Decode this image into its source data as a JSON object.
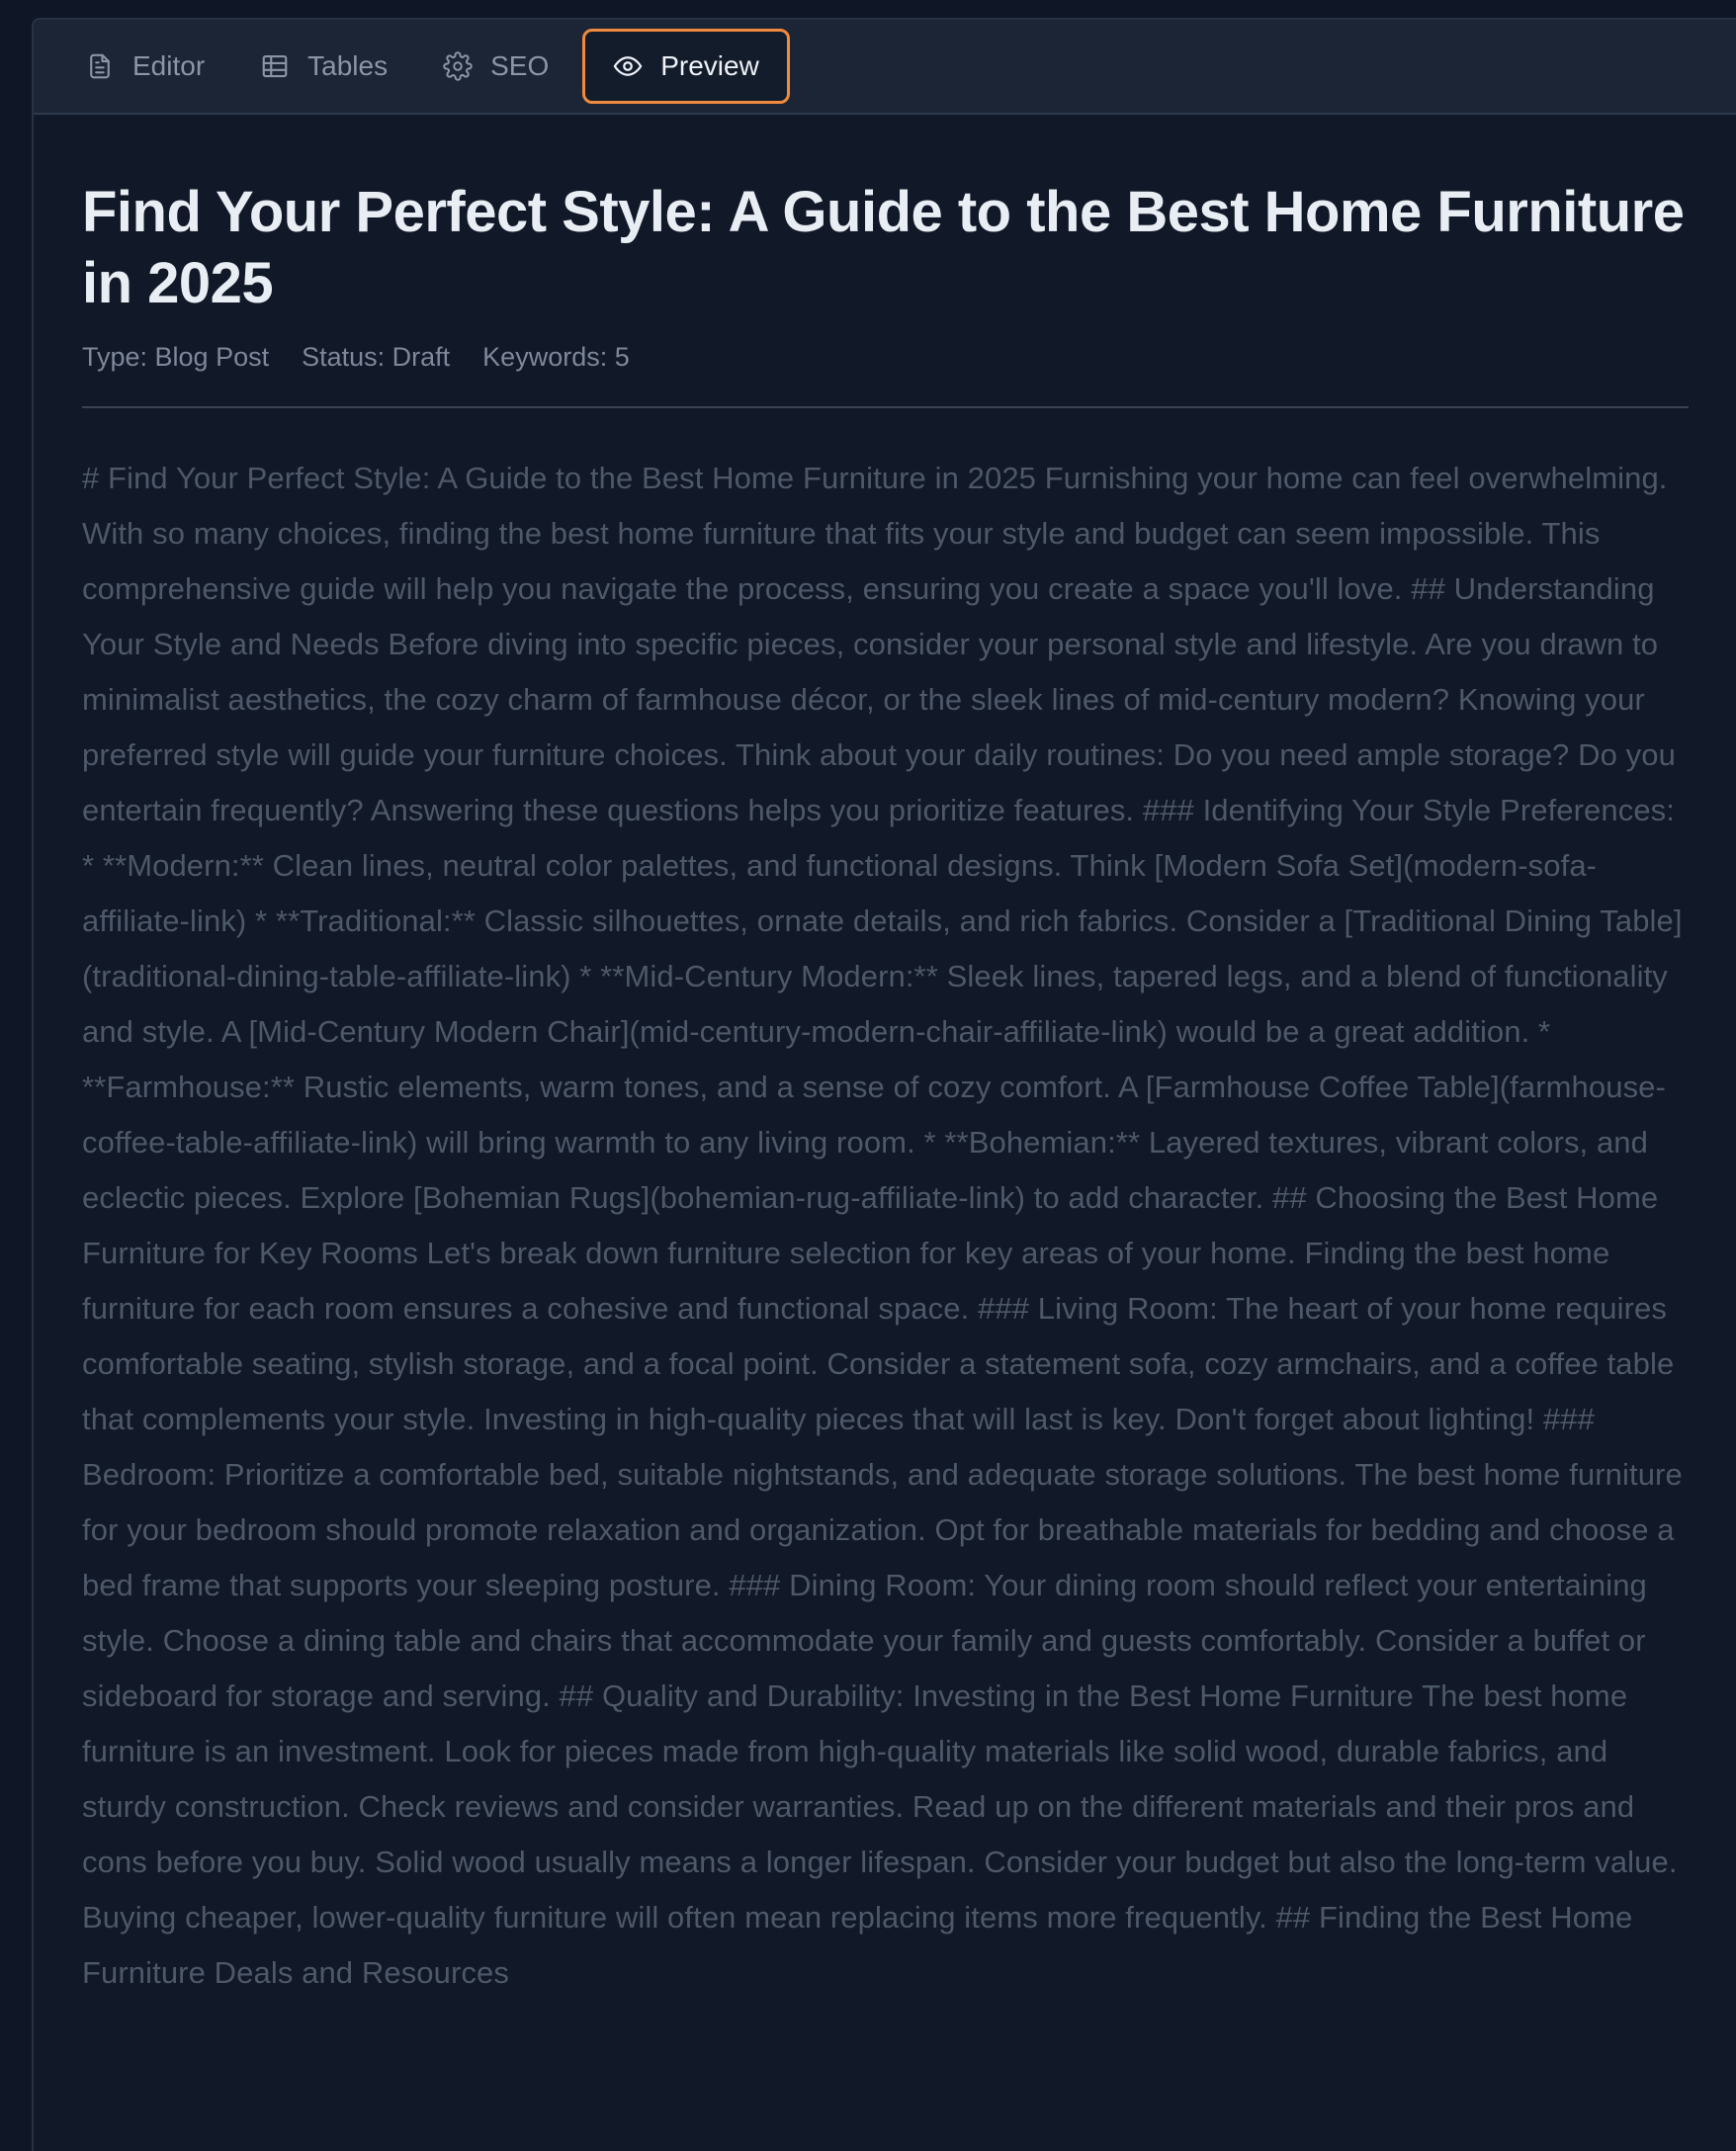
{
  "tabs": [
    {
      "label": "Editor",
      "icon": "document-icon",
      "active": false
    },
    {
      "label": "Tables",
      "icon": "table-icon",
      "active": false
    },
    {
      "label": "SEO",
      "icon": "gear-icon",
      "active": false
    },
    {
      "label": "Preview",
      "icon": "eye-icon",
      "active": true
    }
  ],
  "article": {
    "title": "Find Your Perfect Style: A Guide to the Best Home Furniture in 2025",
    "meta": {
      "type": "Type: Blog Post",
      "status": "Status: Draft",
      "keywords": "Keywords: 5"
    },
    "body": "# Find Your Perfect Style: A Guide to the Best Home Furniture in 2025 Furnishing your home can feel overwhelming. With so many choices, finding the best home furniture that fits your style and budget can seem impossible. This comprehensive guide will help you navigate the process, ensuring you create a space you'll love. ## Understanding Your Style and Needs Before diving into specific pieces, consider your personal style and lifestyle. Are you drawn to minimalist aesthetics, the cozy charm of farmhouse décor, or the sleek lines of mid-century modern? Knowing your preferred style will guide your furniture choices. Think about your daily routines: Do you need ample storage? Do you entertain frequently? Answering these questions helps you prioritize features. ### Identifying Your Style Preferences: * **Modern:** Clean lines, neutral color palettes, and functional designs. Think [Modern Sofa Set](modern-sofa-affiliate-link) * **Traditional:** Classic silhouettes, ornate details, and rich fabrics. Consider a [Traditional Dining Table](traditional-dining-table-affiliate-link) * **Mid-Century Modern:** Sleek lines, tapered legs, and a blend of functionality and style. A [Mid-Century Modern Chair](mid-century-modern-chair-affiliate-link) would be a great addition. * **Farmhouse:** Rustic elements, warm tones, and a sense of cozy comfort. A [Farmhouse Coffee Table](farmhouse-coffee-table-affiliate-link) will bring warmth to any living room. * **Bohemian:** Layered textures, vibrant colors, and eclectic pieces. Explore [Bohemian Rugs](bohemian-rug-affiliate-link) to add character. ## Choosing the Best Home Furniture for Key Rooms Let's break down furniture selection for key areas of your home. Finding the best home furniture for each room ensures a cohesive and functional space. ### Living Room: The heart of your home requires comfortable seating, stylish storage, and a focal point. Consider a statement sofa, cozy armchairs, and a coffee table that complements your style. Investing in high-quality pieces that will last is key. Don't forget about lighting! ### Bedroom: Prioritize a comfortable bed, suitable nightstands, and adequate storage solutions. The best home furniture for your bedroom should promote relaxation and organization. Opt for breathable materials for bedding and choose a bed frame that supports your sleeping posture. ### Dining Room: Your dining room should reflect your entertaining style. Choose a dining table and chairs that accommodate your family and guests comfortably. Consider a buffet or sideboard for storage and serving. ## Quality and Durability: Investing in the Best Home Furniture The best home furniture is an investment. Look for pieces made from high-quality materials like solid wood, durable fabrics, and sturdy construction. Check reviews and consider warranties. Read up on the different materials and their pros and cons before you buy. Solid wood usually means a longer lifespan. Consider your budget but also the long-term value. Buying cheaper, lower-quality furniture will often mean replacing items more frequently. ## Finding the Best Home Furniture Deals and Resources"
  },
  "colors": {
    "accent": "#f08a3e",
    "background": "#111827",
    "tabbar": "#1c2535",
    "body_text": "#4d5869"
  }
}
